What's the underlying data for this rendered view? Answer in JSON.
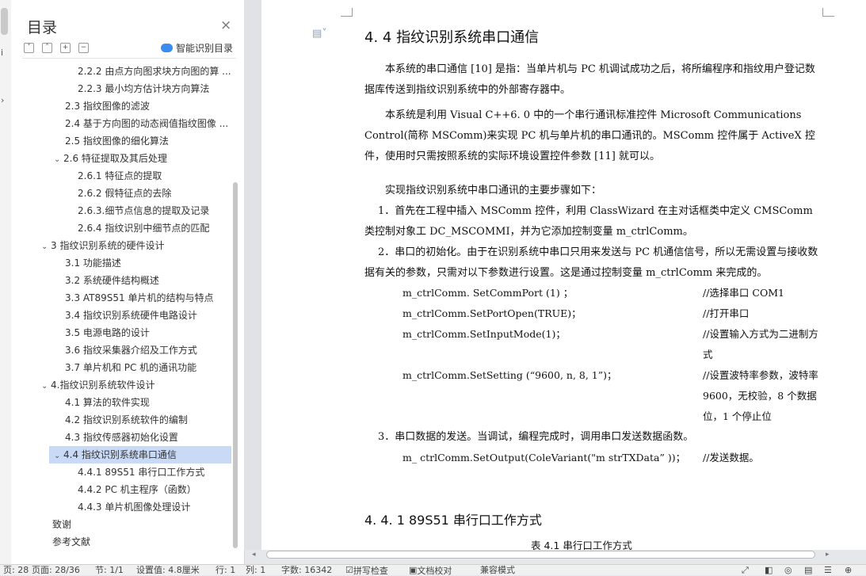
{
  "nav": {
    "title": "目录",
    "smart_toc_label": "智能识别目录",
    "items": [
      {
        "label": "2.2.2 由点方向图求块方向图的算 ...",
        "level": 3
      },
      {
        "label": "2.2.3 最小均方估计块方向算法",
        "level": 3
      },
      {
        "label": "2.3 指纹图像的滤波",
        "level": 2
      },
      {
        "label": "2.4 基于方向图的动态阀值指纹图像 ...",
        "level": 2
      },
      {
        "label": "2.5 指纹图像的细化算法",
        "level": 2
      },
      {
        "label": "2.6 特征提取及其后处理",
        "level": 2,
        "expanded": true
      },
      {
        "label": "2.6.1 特征点的提取",
        "level": 3
      },
      {
        "label": "2.6.2 假特征点的去除",
        "level": 3
      },
      {
        "label": "2.6.3.细节点信息的提取及记录",
        "level": 3
      },
      {
        "label": "2.6.4 指纹识别中细节点的匹配",
        "level": 3
      },
      {
        "label": "3 指纹识别系统的硬件设计",
        "level": 1,
        "expanded": true
      },
      {
        "label": "3.1 功能描述",
        "level": 2
      },
      {
        "label": "3.2 系统硬件结构概述",
        "level": 2
      },
      {
        "label": "3.3    AT89S51 单片机的结构与特点",
        "level": 2
      },
      {
        "label": "3.4 指纹识别系统硬件电路设计",
        "level": 2
      },
      {
        "label": "3.5 电源电路的设计",
        "level": 2
      },
      {
        "label": "3.6 指纹采集器介绍及工作方式",
        "level": 2
      },
      {
        "label": "3.7 单片机和 PC 机的通讯功能",
        "level": 2
      },
      {
        "label": "4.指纹识别系统软件设计",
        "level": 1,
        "expanded": true
      },
      {
        "label": "4.1 算法的软件实现",
        "level": 2
      },
      {
        "label": "4.2 指纹识别系统软件的编制",
        "level": 2
      },
      {
        "label": "4.3 指纹传感器初始化设置",
        "level": 2
      },
      {
        "label": "4.4  指纹识别系统串口通信",
        "level": 2,
        "expanded": true,
        "active": true
      },
      {
        "label": "4.4.1 89S51 串行口工作方式",
        "level": 3
      },
      {
        "label": "4.4.2 PC 机主程序（函数）",
        "level": 3
      },
      {
        "label": "4.4.3 单片机图像处理设计",
        "level": 3
      },
      {
        "label": "致谢",
        "level": 1
      },
      {
        "label": "参考文献",
        "level": 1
      }
    ]
  },
  "doc": {
    "heading": "4. 4  指纹识别系统串口通信",
    "p1": "本系统的串口通信 [10] 是指：当单片机与 PC 机调试成功之后，将所编程序和指纹用户登记数据库传送到指纹识别系统中的外部寄存器中。",
    "p2": "本系统是利用 Visual C++6. 0 中的一个串行通讯标准控件 Microsoft Communications Control(简称 MSComm)来实现 PC 机与单片机的串口通讯的。MSComm 控件属于 ActiveX 控件，使用时只需按照系统的实际环境设置控件参数 [11] 就可以。",
    "p3": "实现指纹识别系统中串口通讯的主要步骤如下：",
    "p4": "1．首先在工程中插入 MSComm 控件，利用 ClassWizard 在主对话框类中定义 CMSComm 类控制对象工 DC_MSCOMMI，并为它添加控制变量 m_ctrlComm。",
    "p5": "2．串口的初始化。由于在识别系统中串口只用来发送与 PC 机通信信号，所以无需设置与接收数据有关的参数，只需对以下参数进行设置。这是通过控制变量 m_ctrlComm 来完成的。",
    "code1": "m_ctrlComm. SetCommPort (1) ；",
    "cmt1": "//选择串口 COM1",
    "code2": "m_ctrlComm.SetPortOpen(TRUE)；",
    "cmt2": "//打开串口",
    "code3": "m_ctrlComm.SetInputMode(1)；",
    "cmt3": "//设置输入方式为二进制方式",
    "code4": "m_ctrlComm.SetSetting (“9600,   n,   8,   1”)；",
    "cmt4": "//设置波特率参数，波特率 9600，无校验，8 个数据位，1 个停止位",
    "p6": "3．串口数据的发送。当调试，编程完成时，调用串口发送数据函数。",
    "code5": "m_ ctrlComm.SetOutput(ColeVariant(\"m strTXData” ))；",
    "cmt5": "//发送数据。",
    "subheading": "4. 4. 1  89S51 串行口工作方式",
    "caption": "表 4.1     串行口工作方式"
  },
  "status": {
    "s1": "页: 28",
    "s2": "页面: 28/36",
    "s3": "节: 1/1",
    "s4": "设置值: 4.8厘米",
    "s5": "行: 1",
    "s6": "列: 1",
    "s7": "字数: 16342",
    "s8": "拼写检查",
    "s9": "文档校对",
    "s10": "兼容模式"
  }
}
